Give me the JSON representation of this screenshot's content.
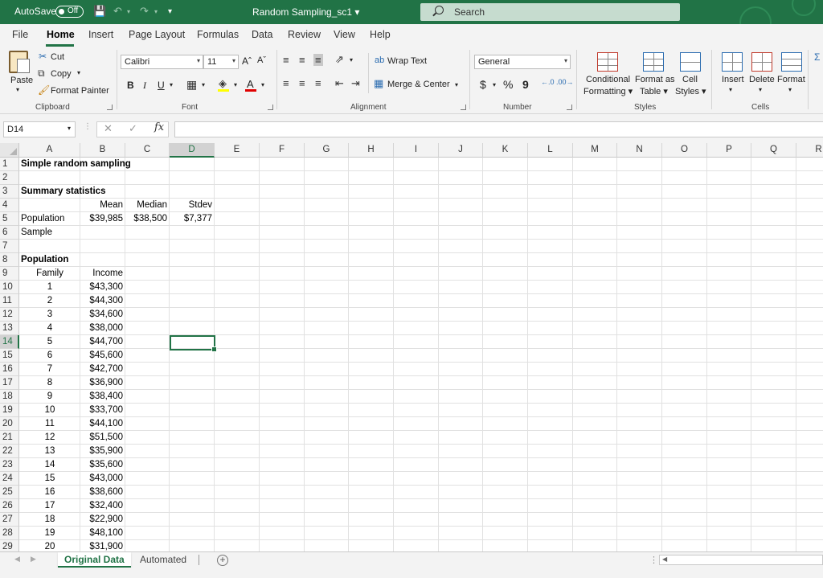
{
  "titlebar": {
    "autosave_label": "AutoSave",
    "autosave_state": "Off",
    "document_title": "Random Sampling_sc1",
    "search_placeholder": "Search"
  },
  "menu": [
    "File",
    "Home",
    "Insert",
    "Page Layout",
    "Formulas",
    "Data",
    "Review",
    "View",
    "Help"
  ],
  "ribbon": {
    "clipboard": {
      "paste": "Paste",
      "cut": "Cut",
      "copy": "Copy",
      "format_painter": "Format Painter",
      "group": "Clipboard"
    },
    "font": {
      "name": "Calibri",
      "size": "11",
      "bold": "B",
      "italic": "I",
      "underline": "U",
      "grow": "Aˆ",
      "shrink": "Aˇ",
      "font_color": "A",
      "group": "Font"
    },
    "alignment": {
      "wrap": "Wrap Text",
      "merge": "Merge & Center",
      "group": "Alignment"
    },
    "number": {
      "format": "General",
      "currency": "$",
      "percent": "%",
      "comma": "9",
      "group": "Number"
    },
    "styles": {
      "conditional_1": "Conditional",
      "conditional_2": "Formatting",
      "format_table_1": "Format as",
      "format_table_2": "Table",
      "cell_styles_1": "Cell",
      "cell_styles_2": "Styles",
      "group": "Styles"
    },
    "cells": {
      "insert": "Insert",
      "delete": "Delete",
      "format": "Format",
      "group": "Cells"
    }
  },
  "formula_bar": {
    "name_box": "D14",
    "fx": "fx",
    "content": ""
  },
  "columns": [
    "A",
    "B",
    "C",
    "D",
    "E",
    "F",
    "G",
    "H",
    "I",
    "J",
    "K",
    "L",
    "M",
    "N",
    "O",
    "P",
    "Q",
    "R"
  ],
  "rows": [
    "1",
    "2",
    "3",
    "4",
    "5",
    "6",
    "7",
    "8",
    "9",
    "10",
    "11",
    "12",
    "13",
    "14",
    "15",
    "16",
    "17",
    "18",
    "19",
    "20",
    "21",
    "22",
    "23",
    "24",
    "25",
    "26",
    "27",
    "28",
    "29"
  ],
  "sheet": {
    "title": "Simple random sampling",
    "summary_title": "Summary statistics",
    "headers": {
      "mean": "Mean",
      "median": "Median",
      "stdev": "Stdev"
    },
    "population_label": "Population",
    "population_stats": {
      "mean": "$39,985",
      "median": "$38,500",
      "stdev": "$7,377"
    },
    "sample_label": "Sample",
    "population_section": "Population",
    "family_header": "Family",
    "income_header": "Income",
    "records": [
      {
        "family": "1",
        "income": "$43,300"
      },
      {
        "family": "2",
        "income": "$44,300"
      },
      {
        "family": "3",
        "income": "$34,600"
      },
      {
        "family": "4",
        "income": "$38,000"
      },
      {
        "family": "5",
        "income": "$44,700"
      },
      {
        "family": "6",
        "income": "$45,600"
      },
      {
        "family": "7",
        "income": "$42,700"
      },
      {
        "family": "8",
        "income": "$36,900"
      },
      {
        "family": "9",
        "income": "$38,400"
      },
      {
        "family": "10",
        "income": "$33,700"
      },
      {
        "family": "11",
        "income": "$44,100"
      },
      {
        "family": "12",
        "income": "$51,500"
      },
      {
        "family": "13",
        "income": "$35,900"
      },
      {
        "family": "14",
        "income": "$35,600"
      },
      {
        "family": "15",
        "income": "$43,000"
      },
      {
        "family": "16",
        "income": "$38,600"
      },
      {
        "family": "17",
        "income": "$32,400"
      },
      {
        "family": "18",
        "income": "$22,900"
      },
      {
        "family": "19",
        "income": "$48,100"
      },
      {
        "family": "20",
        "income": "$31,900"
      }
    ]
  },
  "sheet_tabs": [
    "Original Data",
    "Automated"
  ],
  "colors": {
    "excel_green": "#217346",
    "ribbon_bg": "#f3f3f3"
  }
}
